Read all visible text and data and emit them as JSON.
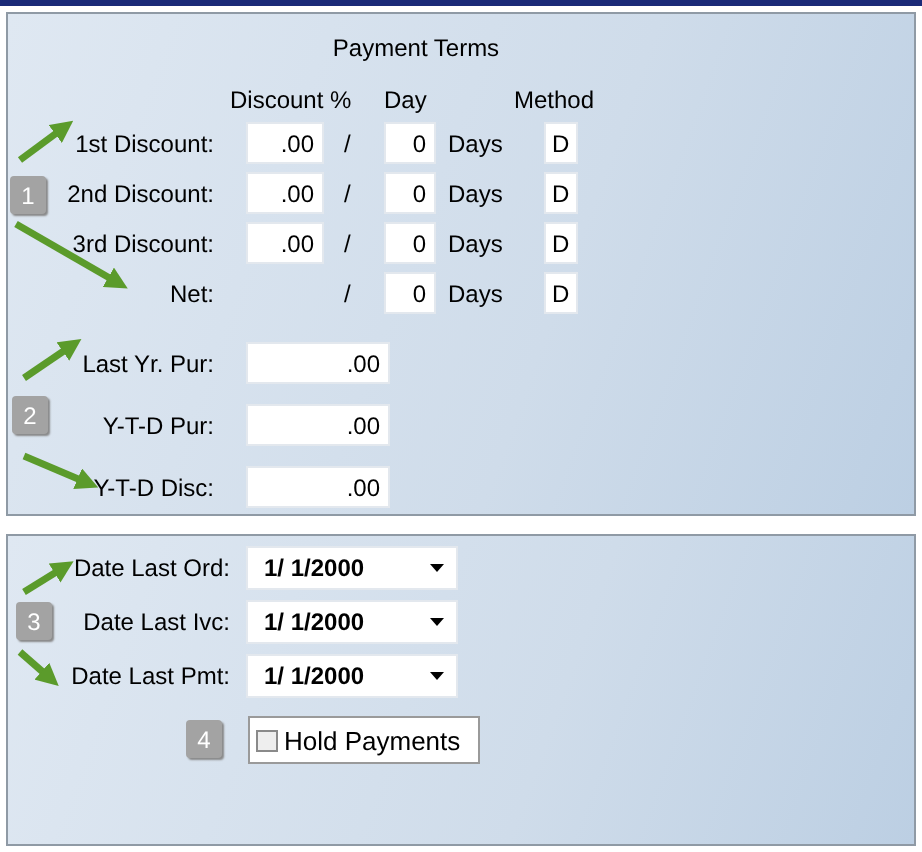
{
  "payment_terms": {
    "title": "Payment Terms",
    "columns": [
      "Discount %",
      "Day",
      "Method"
    ],
    "rows": [
      {
        "label": "1st Discount:",
        "discount": ".00",
        "separator": "/",
        "day": "0",
        "unit": "Days",
        "method": "D"
      },
      {
        "label": "2nd Discount:",
        "discount": ".00",
        "separator": "/",
        "day": "0",
        "unit": "Days",
        "method": "D"
      },
      {
        "label": "3rd Discount:",
        "discount": ".00",
        "separator": "/",
        "day": "0",
        "unit": "Days",
        "method": "D"
      },
      {
        "label": "Net:",
        "separator": "/",
        "day": "0",
        "unit": "Days",
        "method": "D"
      }
    ]
  },
  "purchases": [
    {
      "label": "Last Yr. Pur:",
      "value": ".00"
    },
    {
      "label": "Y-T-D Pur:",
      "value": ".00"
    },
    {
      "label": "Y-T-D Disc:",
      "value": ".00"
    }
  ],
  "dates": [
    {
      "label": "Date Last Ord:",
      "value": "1/ 1/2000"
    },
    {
      "label": "Date Last Ivc:",
      "value": "1/ 1/2000"
    },
    {
      "label": "Date Last Pmt:",
      "value": "1/ 1/2000"
    }
  ],
  "hold_payments": {
    "label": "Hold Payments",
    "checked": false
  },
  "callouts": [
    {
      "number": "1"
    },
    {
      "number": "2"
    },
    {
      "number": "3"
    },
    {
      "number": "4"
    }
  ]
}
